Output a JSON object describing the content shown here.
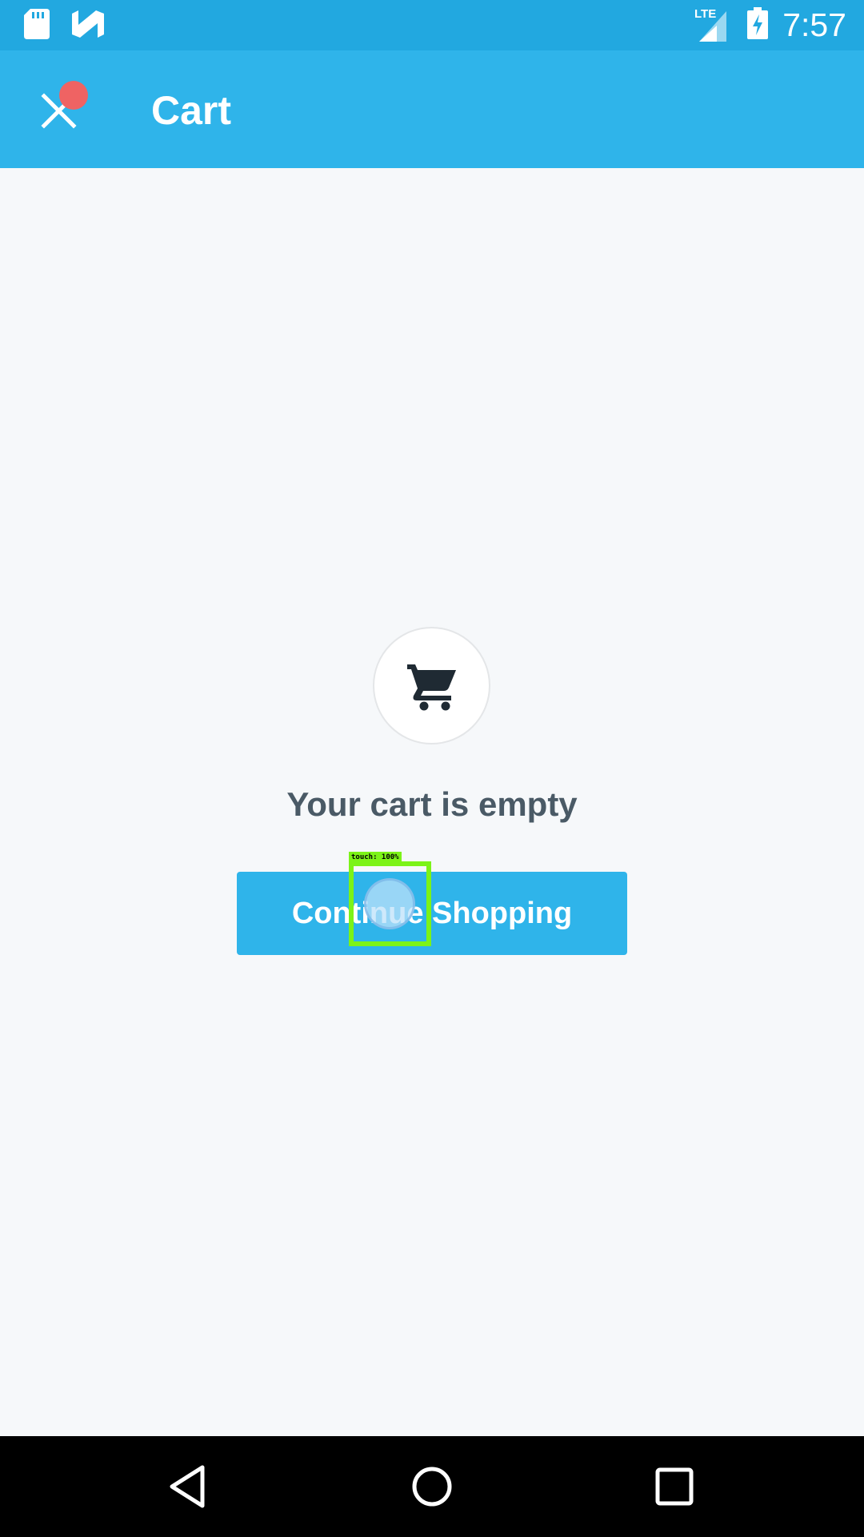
{
  "status_bar": {
    "time": "7:57",
    "network": "LTE",
    "icons": [
      "sd-card-icon",
      "n-notification-icon",
      "signal-icon",
      "battery-charging-icon"
    ]
  },
  "app_bar": {
    "title": "Cart",
    "close_icon": "close-icon"
  },
  "content": {
    "cart_icon": "shopping-cart-icon",
    "empty_message": "Your cart is empty",
    "continue_button_label": "Continue Shopping"
  },
  "touch_overlay": {
    "label": "touch: 100%"
  },
  "nav_bar": {
    "buttons": [
      "back-icon",
      "home-icon",
      "recents-icon"
    ]
  },
  "colors": {
    "status_bar": "#22a8e0",
    "app_bar": "#2fb4ea",
    "accent": "#2fb4ea",
    "background": "#f6f8fa",
    "text_dark": "#4a5a66",
    "notification_dot": "#ef6363"
  }
}
